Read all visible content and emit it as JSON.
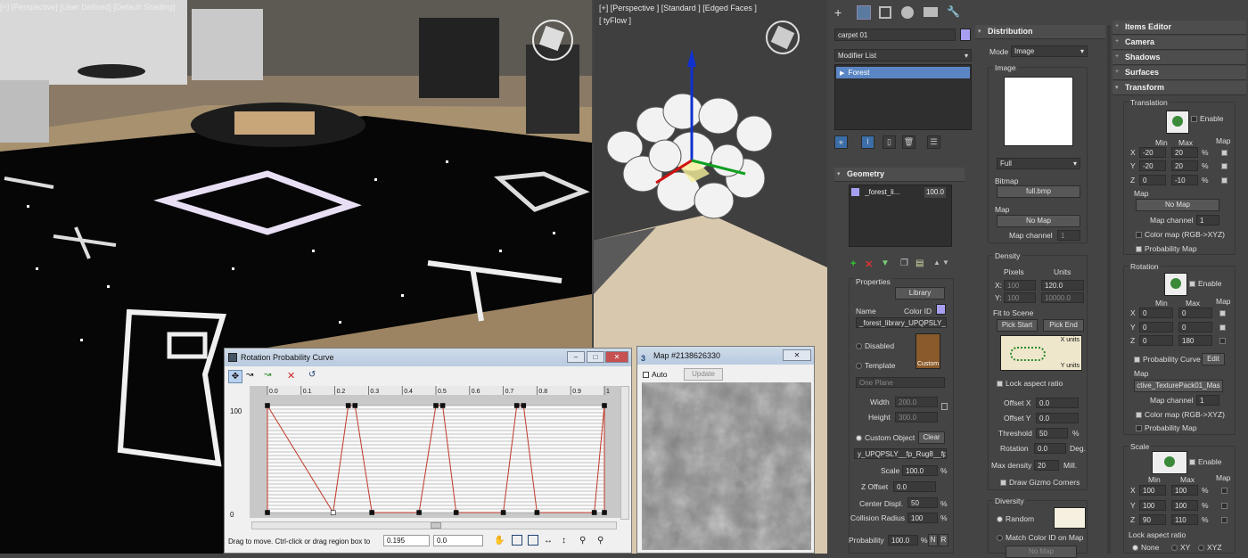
{
  "viewport_left": {
    "label": "[+] [Perspective] [User Defined] [Default Shading]"
  },
  "viewport_mid": {
    "label": "[+] [Perspective ] [Standard ] [Edged Faces ]",
    "sublabel": "[ tyFlow ]"
  },
  "command_panel": {
    "object_name": "carpet 01",
    "modifier_list": "Modifier List",
    "stack_item": "Forest"
  },
  "geometry": {
    "title": "Geometry",
    "list_item_name": "_forest_li...",
    "list_item_value": "100.0",
    "properties": "Properties",
    "library_btn": "Library",
    "name_label": "Name",
    "color_id_label": "Color ID",
    "name_value": "_forest_library_UPQPSLY_",
    "disabled": "Disabled",
    "template": "Template",
    "custom_label": "Custom",
    "one_plane": "One Plane",
    "width_label": "Width",
    "width_value": "200.0",
    "height_label": "Height",
    "height_value": "300.0",
    "custom_object": "Custom Object",
    "clear_btn": "Clear",
    "object_value": "y_UPQPSLY__fp_Rug8__fp_",
    "scale_label": "Scale",
    "scale_value": "100.0",
    "zoffset_label": "Z Offset",
    "zoffset_value": "0.0",
    "center_label": "Center Displ.",
    "center_value": "50",
    "collision_label": "Collision Radius",
    "collision_value": "100",
    "prob_label": "Probability",
    "prob_value": "100.0",
    "pct": "%",
    "n": "N",
    "r": "R"
  },
  "distribution": {
    "title": "Distribution",
    "mode_label": "Mode",
    "mode_value": "Image",
    "image_group": "Image",
    "fit_value": "Full",
    "bitmap_label": "Bitmap",
    "bitmap_value": "full.bmp",
    "map_label": "Map",
    "map_value": "No Map",
    "map_channel_label": "Map channel",
    "map_channel_value": "1",
    "density_group": "Density",
    "pixels": "Pixels",
    "units": "Units",
    "x": "X:",
    "y": "Y:",
    "px_x": "100",
    "px_y": "100",
    "u_x": "120.0",
    "u_y": "10000.0",
    "fit_to_scene": "Fit to Scene",
    "pick_start": "Pick Start",
    "pick_end": "Pick End",
    "x_units": "X units",
    "y_units": "Y units",
    "lock_aspect": "Lock aspect ratio",
    "offset_x_label": "Offset X",
    "offset_x": "0.0",
    "offset_y_label": "Offset Y",
    "offset_y": "0.0",
    "threshold_label": "Threshold",
    "threshold": "50",
    "rotation_label": "Rotation",
    "rotation": "0.0",
    "deg": "Deg.",
    "max_density_label": "Max density",
    "max_density": "20",
    "mill": "Mill.",
    "draw_gizmo": "Draw Gizmo Corners",
    "diversity_group": "Diversity",
    "random": "Random",
    "match_color": "Match Color ID on Map",
    "no_map": "No Map"
  },
  "right_panel": {
    "items_editor": "Items Editor",
    "camera": "Camera",
    "shadows": "Shadows",
    "surfaces": "Surfaces",
    "transform": "Transform",
    "translation": "Translation",
    "enable": "Enable",
    "min": "Min",
    "max": "Max",
    "map": "Map",
    "t_rows": [
      {
        "axis": "X",
        "min": "-20",
        "max": "20",
        "pct": "%"
      },
      {
        "axis": "Y",
        "min": "-20",
        "max": "20",
        "pct": "%"
      },
      {
        "axis": "Z",
        "min": "0",
        "max": "-10",
        "pct": "%"
      }
    ],
    "no_map": "No Map",
    "map_channel_label": "Map channel",
    "map_channel": "1",
    "color_map": "Color map (RGB->XYZ)",
    "probability_map": "Probability Map",
    "rotation": "Rotation",
    "r_rows": [
      {
        "axis": "X",
        "min": "0",
        "max": "0"
      },
      {
        "axis": "Y",
        "min": "0",
        "max": "0"
      },
      {
        "axis": "Z",
        "min": "0",
        "max": "180"
      }
    ],
    "probability_curve": "Probability Curve",
    "edit": "Edit",
    "rot_map_value": "ctive_TexturePack01_Mas",
    "scale": "Scale",
    "s_rows": [
      {
        "axis": "X",
        "min": "100",
        "max": "100",
        "pct": "%"
      },
      {
        "axis": "Y",
        "min": "100",
        "max": "100",
        "pct": "%"
      },
      {
        "axis": "Z",
        "min": "90",
        "max": "110",
        "pct": "%"
      }
    ],
    "lock_aspect": "Lock aspect ratio",
    "none": "None",
    "xy": "XY",
    "xyz": "XYZ"
  },
  "curve_window": {
    "title": "Rotation Probability Curve",
    "ticks": [
      "0.0",
      "0.1",
      "0.2",
      "0.3",
      "0.4",
      "0.5",
      "0.6",
      "0.7",
      "0.8",
      "0.9",
      "1"
    ],
    "y_top": "100",
    "y_bottom": "0",
    "status": "Drag to move. Ctrl-click or drag region box to",
    "coord_x": "0.195",
    "coord_y": "0.0"
  },
  "map_window": {
    "title": "Map #2138626330",
    "auto": "Auto",
    "update": "Update"
  },
  "chart_data": {
    "type": "line",
    "x": [
      0.0,
      0.0,
      0.195,
      0.24,
      0.26,
      0.31,
      0.45,
      0.5,
      0.52,
      0.56,
      0.7,
      0.74,
      0.76,
      0.8,
      0.97,
      1.0,
      1.0
    ],
    "values": [
      0,
      100,
      0,
      100,
      100,
      0,
      0,
      100,
      100,
      0,
      0,
      100,
      100,
      0,
      0,
      100,
      0
    ],
    "ylim": [
      0,
      100
    ],
    "xlim": [
      0,
      1
    ]
  },
  "colors": {
    "accent": "#a7a0f0",
    "curve": "#c0392b",
    "panel": "#444444"
  }
}
